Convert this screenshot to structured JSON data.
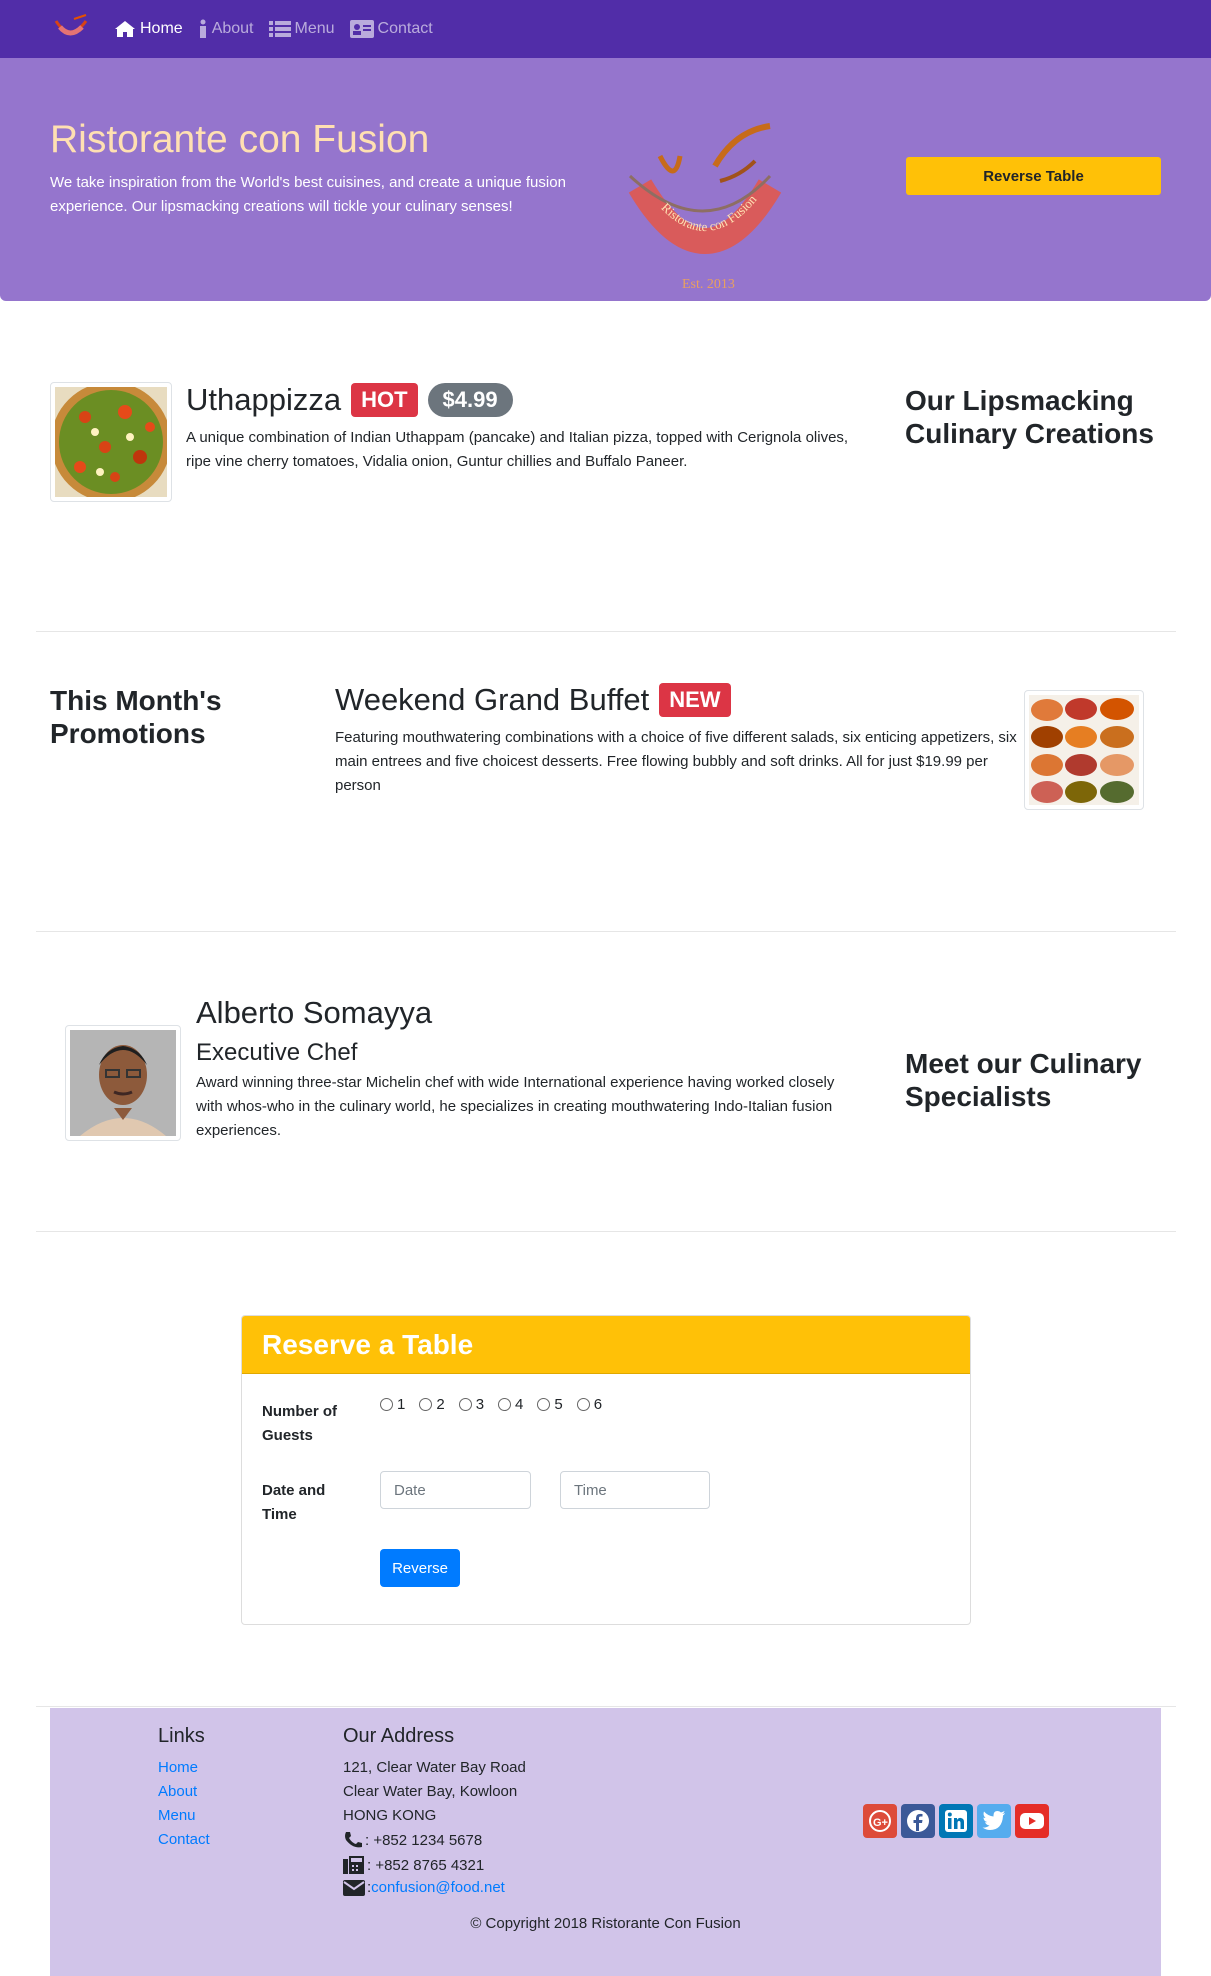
{
  "nav": {
    "items": [
      {
        "label": "Home",
        "icon": "home-icon",
        "active": true
      },
      {
        "label": "About",
        "icon": "info-icon",
        "active": false
      },
      {
        "label": "Menu",
        "icon": "list-icon",
        "active": false
      },
      {
        "label": "Contact",
        "icon": "address-card-icon",
        "active": false
      }
    ]
  },
  "jumbotron": {
    "title": "Ristorante con Fusion",
    "text": "We take inspiration from the World's best cuisines, and create a unique fusion experience. Our lipsmacking creations will tickle your culinary senses!",
    "logo_text": "Ristorante con Fusion",
    "logo_est": "Est. 2013",
    "button": "Reverse Table"
  },
  "dish": {
    "name": "Uthappizza",
    "badge": "HOT",
    "price": "$4.99",
    "description": "A unique combination of Indian Uthappam (pancake) and Italian pizza, topped with Cerignola olives, ripe vine cherry tomatoes, Vidalia onion, Guntur chillies and Buffalo Paneer.",
    "section_title": "Our Lipsmacking Culinary Creations"
  },
  "promotion": {
    "section_title": "This Month's Promotions",
    "name": "Weekend Grand Buffet",
    "badge": "NEW",
    "description": "Featuring mouthwatering combinations with a choice of five different salads, six enticing appetizers, six main entrees and five choicest desserts. Free flowing bubbly and soft drinks. All for just $19.99 per person"
  },
  "leader": {
    "name": "Alberto Somayya",
    "designation": "Executive Chef",
    "description": "Award winning three-star Michelin chef with wide International experience having worked closely with whos-who in the culinary world, he specializes in creating mouthwatering Indo-Italian fusion experiences.",
    "section_title": "Meet our Culinary Specialists"
  },
  "reserve": {
    "title": "Reserve a Table",
    "guests_label": "Number of Guests",
    "guest_options": [
      "1",
      "2",
      "3",
      "4",
      "5",
      "6"
    ],
    "datetime_label": "Date and Time",
    "date_placeholder": "Date",
    "time_placeholder": "Time",
    "submit": "Reverse"
  },
  "footer": {
    "links_title": "Links",
    "links": [
      "Home",
      "About",
      "Menu",
      "Contact"
    ],
    "address_title": "Our Address",
    "address": [
      "121, Clear Water Bay Road",
      "Clear Water Bay, Kowloon",
      "HONG KONG"
    ],
    "phone": ": +852 1234 5678",
    "fax": ": +852 8765 4321",
    "email": "confusion@food.net",
    "social": [
      "google-plus-icon",
      "facebook-icon",
      "linkedin-icon",
      "twitter-icon",
      "youtube-icon"
    ],
    "copyright": "© Copyright 2018 Ristorante Con Fusion"
  },
  "colors": {
    "navbar": "#512DA8",
    "jumbotron": "#9575CD",
    "title": "#FFE0B2",
    "warning": "#FFC107",
    "footer": "#D1C4E9",
    "danger": "#DC3545",
    "primary": "#007BFF"
  }
}
